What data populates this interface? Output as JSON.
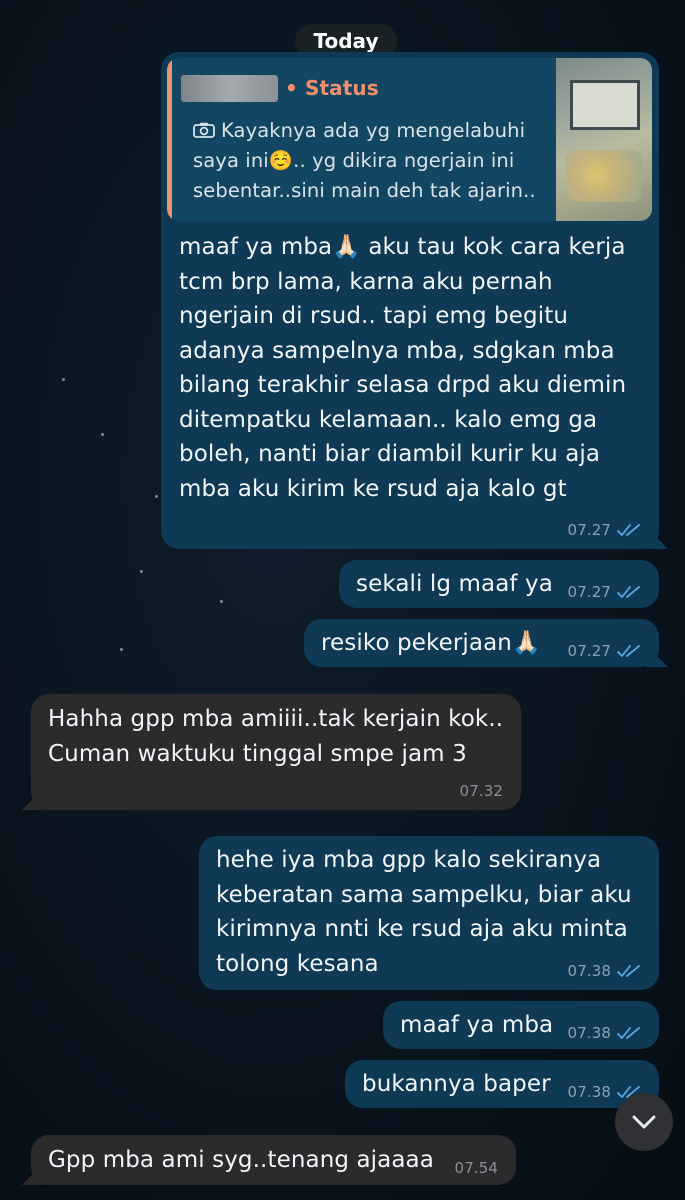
{
  "date_separator": "Today",
  "colors": {
    "outgoing_bubble": "#0f3a55",
    "incoming_bubble": "#2b2b2d",
    "reply_accent": "#f2906d",
    "read_ticks": "#5aa6e6"
  },
  "messages": [
    {
      "direction": "outgoing",
      "reply": {
        "label": "Status",
        "icon": "camera-icon",
        "text": "Kayaknya ada yg mengelabuhi saya ini☺️.. yg dikira ngerjain ini sebentar..sini main deh tak ajarin.."
      },
      "text": "maaf ya mba🙏🏻 aku tau kok cara kerja\ntcm brp lama, karna aku pernah\nngerjain di rsud.. tapi emg begitu\nadanya sampelnya mba, sdgkan mba\nbilang terakhir selasa drpd aku diemin\nditempatku kelamaan.. kalo emg ga\nboleh, nanti biar diambil kurir ku aja\nmba aku kirim ke rsud aja kalo gt",
      "time": "07.27",
      "status": "read"
    },
    {
      "direction": "outgoing",
      "text": "sekali lg maaf ya",
      "time": "07.27",
      "status": "read"
    },
    {
      "direction": "outgoing",
      "text": "resiko pekerjaan🙏🏻",
      "time": "07.27",
      "status": "read"
    },
    {
      "direction": "incoming",
      "text": "Hahha gpp mba amiiii..tak kerjain kok..\nCuman waktuku tinggal smpe jam 3",
      "time": "07.32"
    },
    {
      "direction": "outgoing",
      "text": "hehe iya mba gpp kalo sekiranya\nkeberatan sama sampelku, biar aku\nkirimnya nnti ke rsud aja aku minta\ntolong kesana",
      "time": "07.38",
      "status": "read"
    },
    {
      "direction": "outgoing",
      "text": "maaf ya mba",
      "time": "07.38",
      "status": "read"
    },
    {
      "direction": "outgoing",
      "text": "bukannya baper",
      "time": "07.38",
      "status": "read"
    },
    {
      "direction": "incoming",
      "text": "Gpp mba ami syg..tenang ajaaaa",
      "time": "07.54"
    }
  ],
  "scroll_button": {
    "icon": "chevron-down-icon"
  }
}
